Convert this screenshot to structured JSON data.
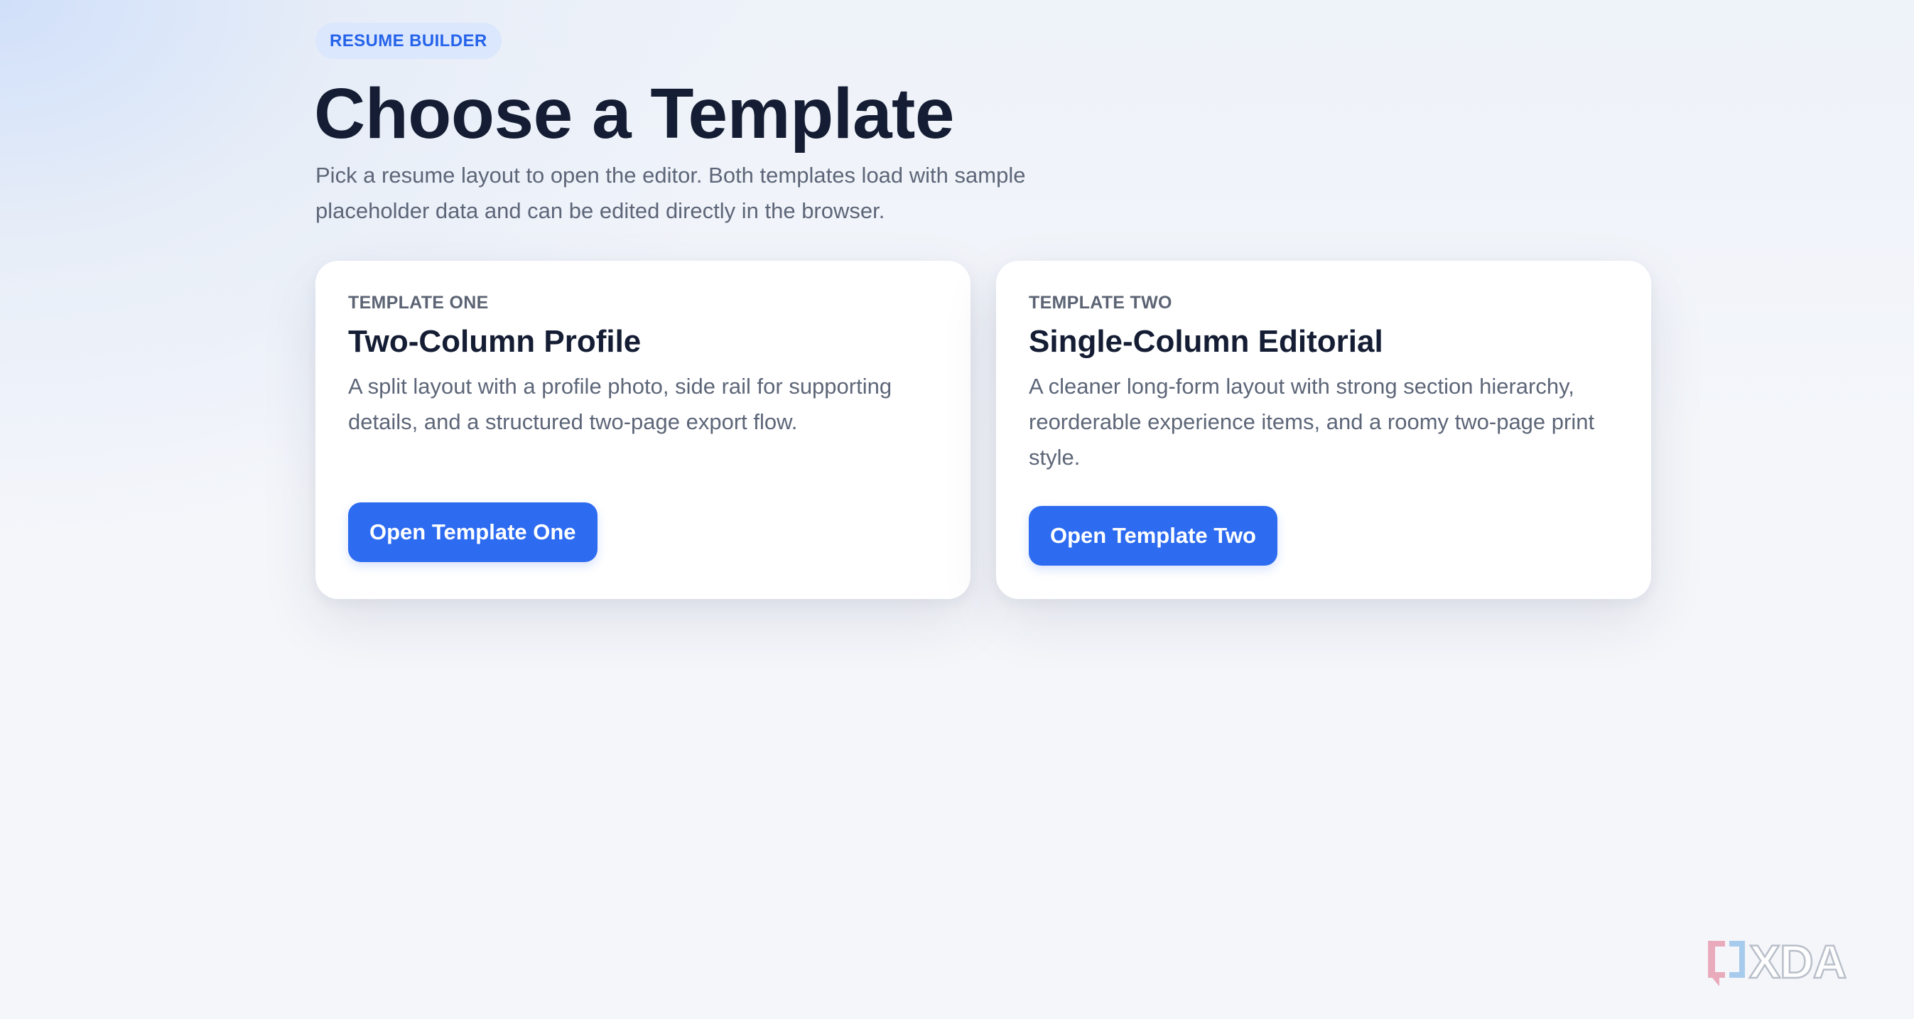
{
  "header": {
    "eyebrow": "RESUME BUILDER",
    "title": "Choose a Template",
    "subtitle": "Pick a resume layout to open the editor. Both templates load with sample placeholder data and can be edited directly in the browser."
  },
  "cards": [
    {
      "kicker": "TEMPLATE ONE",
      "title": "Two-Column Profile",
      "description": "A split layout with a profile photo, side rail for supporting details, and a structured two-page export flow.",
      "button_label": "Open Template One"
    },
    {
      "kicker": "TEMPLATE TWO",
      "title": "Single-Column Editorial",
      "description": "A cleaner long-form layout with strong section hierarchy, reorderable experience items, and a roomy two-page print style.",
      "button_label": "Open Template Two"
    }
  ],
  "watermark": {
    "text": "XDA",
    "icon": "xda-logo-icon"
  },
  "colors": {
    "accent": "#2d6bf0",
    "eyebrow_bg": "#dbe7fc",
    "eyebrow_text": "#2563eb",
    "heading": "#141d33",
    "muted_text": "#5d6678"
  }
}
